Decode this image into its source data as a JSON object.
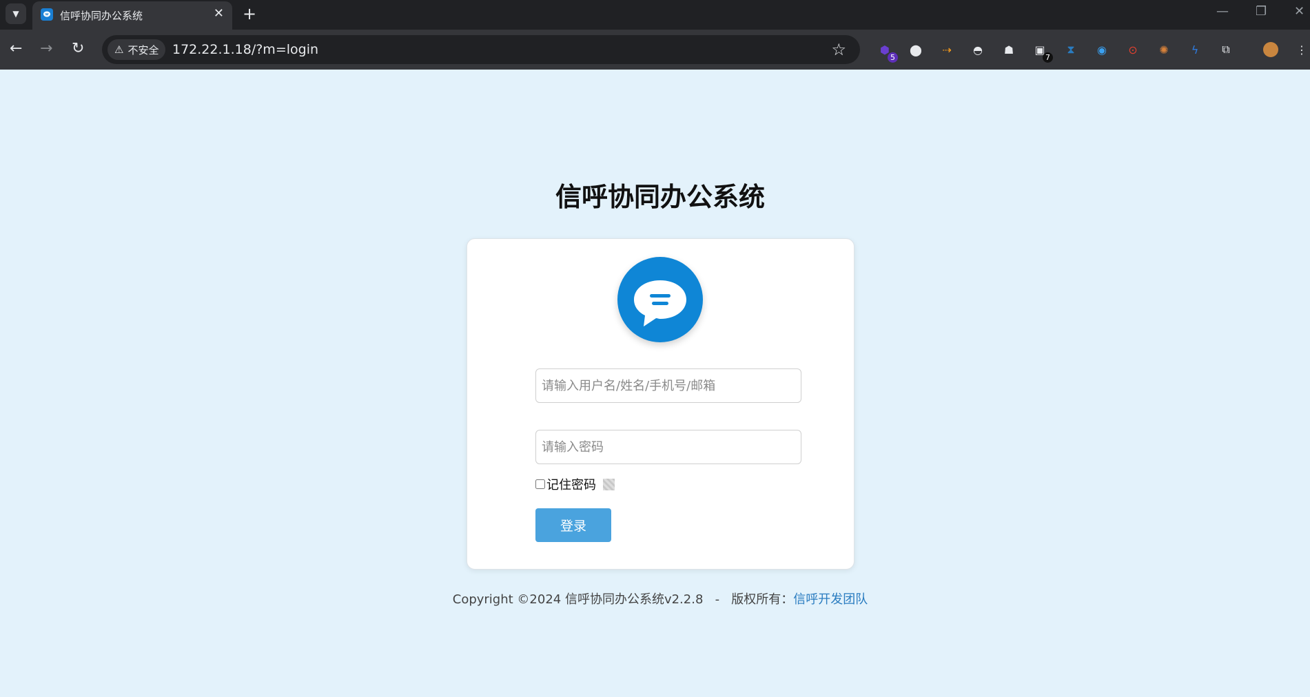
{
  "browser": {
    "tab_title": "信呼协同办公系统",
    "security_label": "不安全",
    "url": "172.22.1.18/?m=login",
    "extension_badges": {
      "first": "5",
      "second": "7"
    }
  },
  "page": {
    "title": "信呼协同办公系统",
    "username_placeholder": "请输入用户名/姓名/手机号/邮箱",
    "password_placeholder": "请输入密码",
    "remember_label": "记住密码",
    "login_label": "登录",
    "footer_text": "Copyright ©2024 信呼协同办公系统v2.2.8   -   版权所有：",
    "footer_link": "信呼开发团队"
  },
  "colors": {
    "accent": "#0f86d6",
    "button": "#4aa3de",
    "background": "#e3f2fb"
  }
}
